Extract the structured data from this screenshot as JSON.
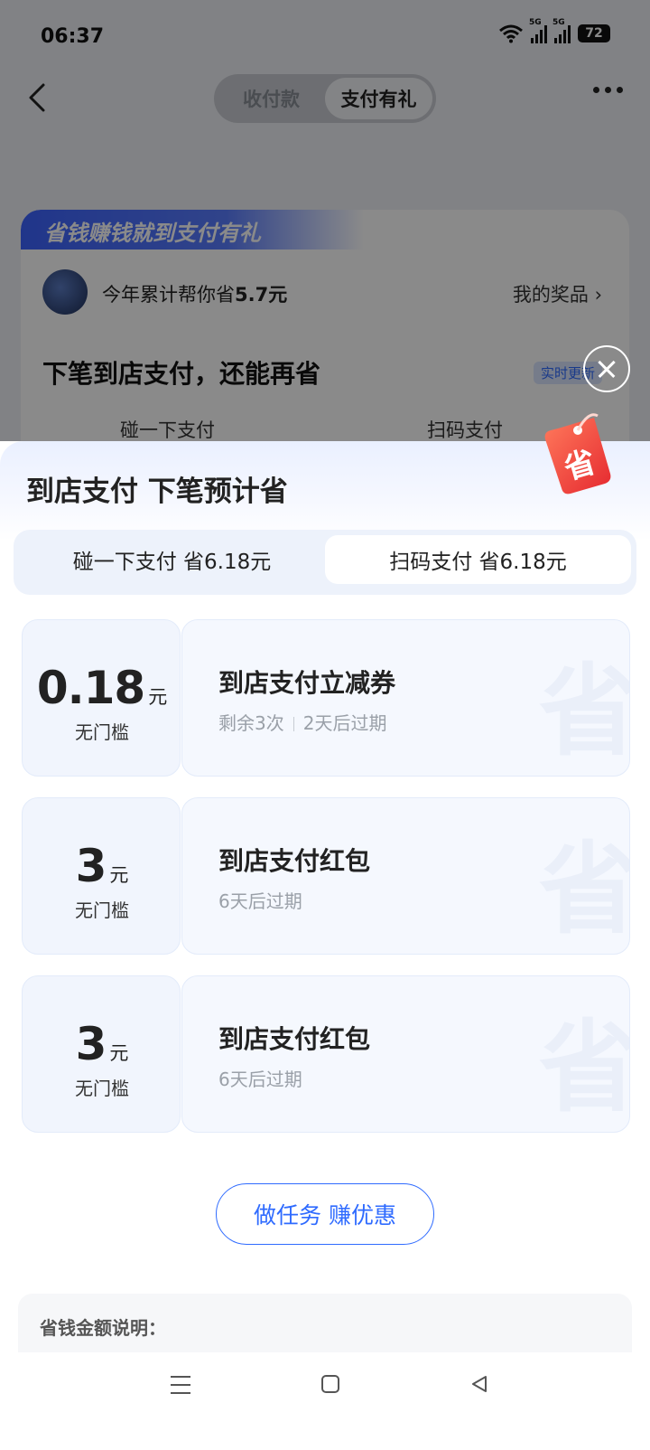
{
  "status": {
    "time": "06:37",
    "battery": "72",
    "network": "5G"
  },
  "nav": {
    "tabs": [
      {
        "label": "收付款"
      },
      {
        "label": "支付有礼"
      }
    ]
  },
  "background_card": {
    "banner": "省钱赚钱就到支付有礼",
    "saved_prefix": "今年累计帮你省",
    "saved_amount": "5.7元",
    "prizes_link": "我的奖品 ›",
    "heading": "下笔到店支付，还能再省",
    "realtime_badge": "实时更新",
    "option1": "碰一下支付",
    "option2": "扫码支付"
  },
  "sheet": {
    "title": "到店支付 下笔预计省",
    "tag_char": "省",
    "pay_tabs": [
      {
        "label": "碰一下支付 省6.18元"
      },
      {
        "label": "扫码支付 省6.18元"
      }
    ],
    "coupons": [
      {
        "amount": "0.18",
        "unit": "元",
        "condition": "无门槛",
        "title": "到店支付立减券",
        "remaining": "剩余3次",
        "expiry": "2天后过期"
      },
      {
        "amount": "3",
        "unit": "元",
        "condition": "无门槛",
        "title": "到店支付红包",
        "remaining": "",
        "expiry": "6天后过期"
      },
      {
        "amount": "3",
        "unit": "元",
        "condition": "无门槛",
        "title": "到店支付红包",
        "remaining": "",
        "expiry": "6天后过期"
      }
    ],
    "watermark": "省",
    "task_button": "做任务 赚优惠",
    "explain_title": "省钱金额说明："
  },
  "colors": {
    "accent": "#2f6bff",
    "tag_red": "#f0453a"
  }
}
